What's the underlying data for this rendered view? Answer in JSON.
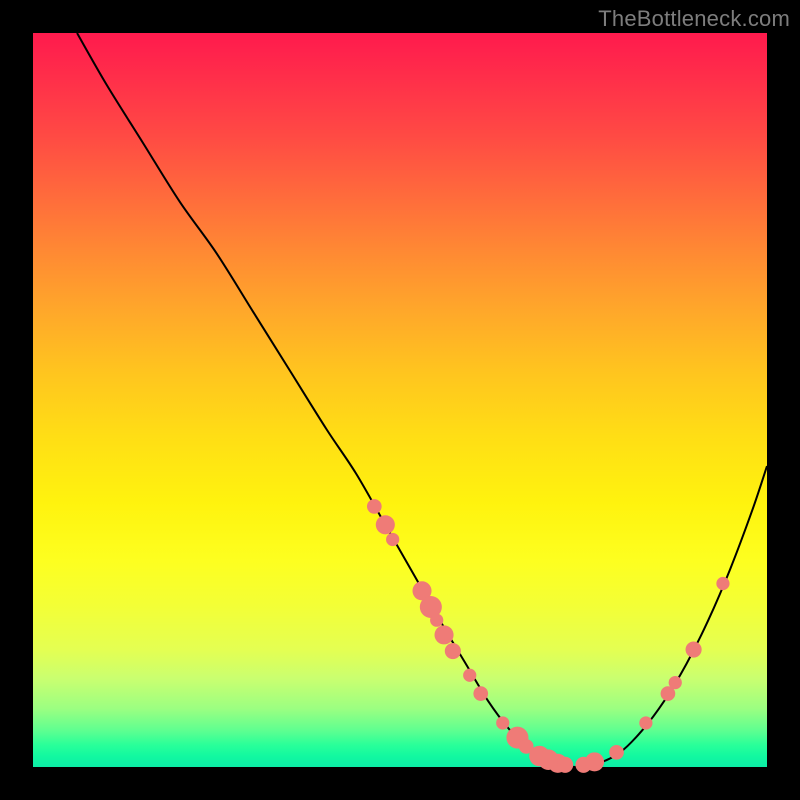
{
  "watermark": "TheBottleneck.com",
  "colors": {
    "curve_stroke": "#000000",
    "dots_fill": "#ef7b77",
    "background_black": "#000000"
  },
  "chart_data": {
    "type": "line",
    "title": "",
    "xlabel": "",
    "ylabel": "",
    "xlim": [
      0,
      100
    ],
    "ylim": [
      0,
      100
    ],
    "series": [
      {
        "name": "bottleneck-curve",
        "x": [
          6,
          10,
          15,
          20,
          25,
          30,
          35,
          40,
          44,
          48,
          52,
          56,
          59,
          62,
          65,
          68,
          71,
          74,
          77,
          80,
          83,
          86,
          89,
          92,
          95,
          98,
          100
        ],
        "y": [
          100,
          93,
          85,
          77,
          70,
          62,
          54,
          46,
          40,
          33,
          26,
          19,
          14,
          9,
          5,
          2,
          0.5,
          0,
          0.5,
          2,
          5,
          9,
          14,
          20,
          27,
          35,
          41
        ]
      }
    ],
    "highlight_points": {
      "name": "highlight-dots",
      "points": [
        {
          "x": 46.5,
          "y": 35.5,
          "r": 1.0
        },
        {
          "x": 48.0,
          "y": 33.0,
          "r": 1.3
        },
        {
          "x": 49.0,
          "y": 31.0,
          "r": 0.9
        },
        {
          "x": 53.0,
          "y": 24.0,
          "r": 1.3
        },
        {
          "x": 54.2,
          "y": 21.8,
          "r": 1.5
        },
        {
          "x": 55.0,
          "y": 20.0,
          "r": 0.9
        },
        {
          "x": 56.0,
          "y": 18.0,
          "r": 1.3
        },
        {
          "x": 57.2,
          "y": 15.8,
          "r": 1.1
        },
        {
          "x": 59.5,
          "y": 12.5,
          "r": 0.9
        },
        {
          "x": 61.0,
          "y": 10.0,
          "r": 1.0
        },
        {
          "x": 64.0,
          "y": 6.0,
          "r": 0.9
        },
        {
          "x": 66.0,
          "y": 4.0,
          "r": 1.5
        },
        {
          "x": 67.2,
          "y": 2.8,
          "r": 1.0
        },
        {
          "x": 69.0,
          "y": 1.5,
          "r": 1.4
        },
        {
          "x": 70.2,
          "y": 1.0,
          "r": 1.4
        },
        {
          "x": 71.5,
          "y": 0.5,
          "r": 1.3
        },
        {
          "x": 72.5,
          "y": 0.3,
          "r": 1.1
        },
        {
          "x": 75.0,
          "y": 0.3,
          "r": 1.1
        },
        {
          "x": 76.5,
          "y": 0.7,
          "r": 1.3
        },
        {
          "x": 79.5,
          "y": 2.0,
          "r": 1.0
        },
        {
          "x": 83.5,
          "y": 6.0,
          "r": 0.9
        },
        {
          "x": 86.5,
          "y": 10.0,
          "r": 1.0
        },
        {
          "x": 87.5,
          "y": 11.5,
          "r": 0.9
        },
        {
          "x": 90.0,
          "y": 16.0,
          "r": 1.1
        },
        {
          "x": 94.0,
          "y": 25.0,
          "r": 0.9
        }
      ]
    }
  }
}
